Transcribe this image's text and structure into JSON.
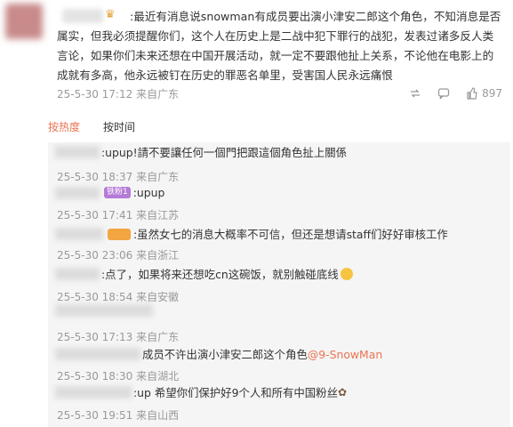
{
  "post": {
    "text": ":最近有消息说snowman有成员要出演小津安二郎这个角色，不知消息是否属实，但我必须提醒你们，这个人在历史上是二战中犯下罪行的战犯，发表过诸多反人类言论，如果你们未来还想在中国开展活动，就一定不要跟他扯上关系，不论他在电影上的成就有多高，他永远被钉在历史的罪恶名单里，受害国人民永远痛恨",
    "timestamp": "25-5-30 17:12",
    "location": "来自广东",
    "like_count": "897"
  },
  "tabs": {
    "hot": "按热度",
    "time": "按时间"
  },
  "comments": [
    {
      "text": ":upup!請不要讓任何一個門把跟這個角色扯上關係",
      "timestamp": "25-5-30 18:37",
      "location": "来自广东"
    },
    {
      "text": ":upup",
      "tag": "铁粉1",
      "timestamp": "25-5-30 17:41",
      "location": "来自江苏"
    },
    {
      "text": ":虽然女七的消息大概率不可信，但还是想请staff们好好审核工作",
      "timestamp": "25-5-30 23:06",
      "location": "来自浙江"
    },
    {
      "text": ":点了，如果将来还想吃cn这碗饭，就别触碰底线",
      "timestamp": "25-5-30 18:54",
      "location": "来自安徽"
    },
    {
      "text": "",
      "timestamp": "25-5-30 17:13",
      "location": "来自广东"
    },
    {
      "text": "成员不许出演小津安二郎这个角色",
      "mention": "@9-SnowMan",
      "timestamp": "25-5-30 18:30",
      "location": "来自湖北"
    },
    {
      "text": ":up 希望你们保护好9个人和所有中国粉丝",
      "timestamp": "25-5-30 19:51",
      "location": "来自山西"
    }
  ]
}
